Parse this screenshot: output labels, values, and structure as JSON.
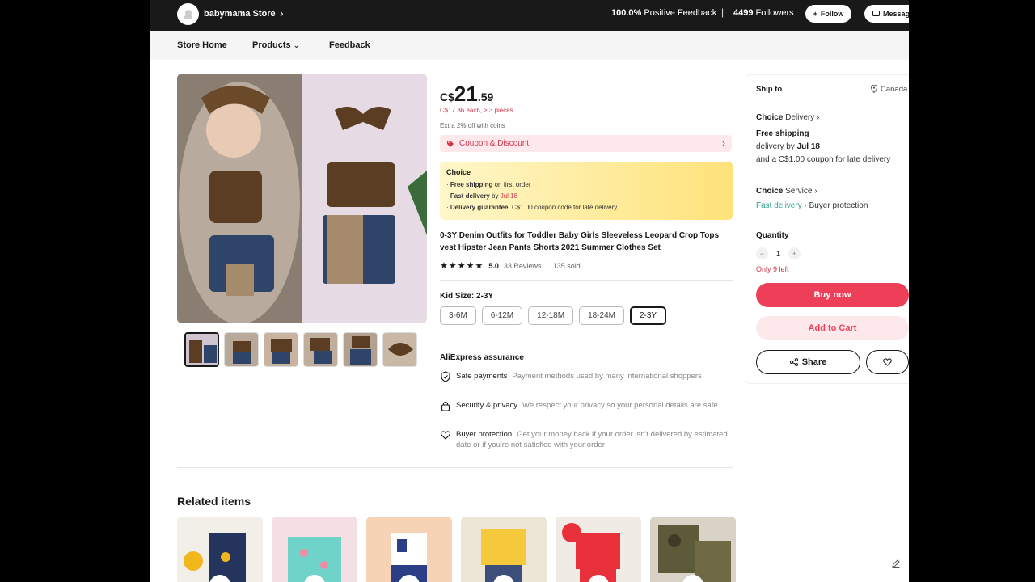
{
  "store": {
    "name": "babymama Store",
    "feedback_value": "100.0%",
    "feedback_label": "Positive Feedback",
    "followers_value": "4499",
    "followers_label": "Followers",
    "follow_label": "Follow",
    "message_label": "Message"
  },
  "nav": {
    "items": [
      {
        "label": "Store Home"
      },
      {
        "label": "Products"
      },
      {
        "label": "Feedback"
      }
    ]
  },
  "product": {
    "price_currency": "C$",
    "price_int": "21",
    "price_dec": ".59",
    "unit_price": "C$17.86 each, ≥ 3 pieces",
    "coins": "Extra 2% off with coins",
    "coupon_label": "Coupon & Discount",
    "choice": {
      "title": "Choice",
      "free_shipping": "Free shipping",
      "free_shipping_rest": "on first order",
      "fast_delivery": "Fast delivery",
      "fast_delivery_by": "by",
      "fast_delivery_date": "Jul 18",
      "guarantee": "Delivery guarantee",
      "guarantee_rest": "C$1.00 coupon code for late delivery"
    },
    "title": "0-3Y Denim Outfits for Toddler Baby Girls Sleeveless Leopard Crop Tops vest Hipster Jean Pants Shorts 2021 Summer Clothes Set",
    "rating": "5.0",
    "reviews": "33 Reviews",
    "sold": "135 sold",
    "size_label": "Kid Size: 2-3Y",
    "sizes": [
      "3-6M",
      "6-12M",
      "12-18M",
      "18-24M",
      "2-3Y"
    ],
    "selected_size": "2-3Y",
    "assurance": {
      "title": "AliExpress assurance",
      "items": [
        {
          "name": "Safe payments",
          "desc": "Payment methods used by many international shoppers"
        },
        {
          "name": "Security & privacy",
          "desc": "We respect your privacy so your personal details are safe"
        },
        {
          "name": "Buyer protection",
          "desc": "Get your money back if your order isn't delivered by estimated date or if you're not satisfied with your order"
        }
      ]
    },
    "thumbnail_count": 6
  },
  "related": {
    "title": "Related items",
    "cart_icon_label": "+"
  },
  "panel": {
    "ship_to": "Ship to",
    "country": "Canada",
    "choice_delivery_a": "Choice",
    "choice_delivery_b": "Delivery",
    "free_shipping": "Free shipping",
    "delivery_by": "delivery by",
    "delivery_date": "Jul 18",
    "late_coupon": "and a C$1.00 coupon for late delivery",
    "choice_service_a": "Choice",
    "choice_service_b": "Service",
    "fast_delivery": "Fast delivery",
    "buyer_protection": "· Buyer protection",
    "quantity_label": "Quantity",
    "quantity_value": "1",
    "only_left": "Only 9 left",
    "buy_now": "Buy now",
    "add_to_cart": "Add to Cart",
    "share": "Share"
  },
  "colors": {
    "accent": "#ee3f58",
    "topbar": "#191919",
    "choice_yellow": "#ffe27a",
    "green": "#2f9e88"
  }
}
